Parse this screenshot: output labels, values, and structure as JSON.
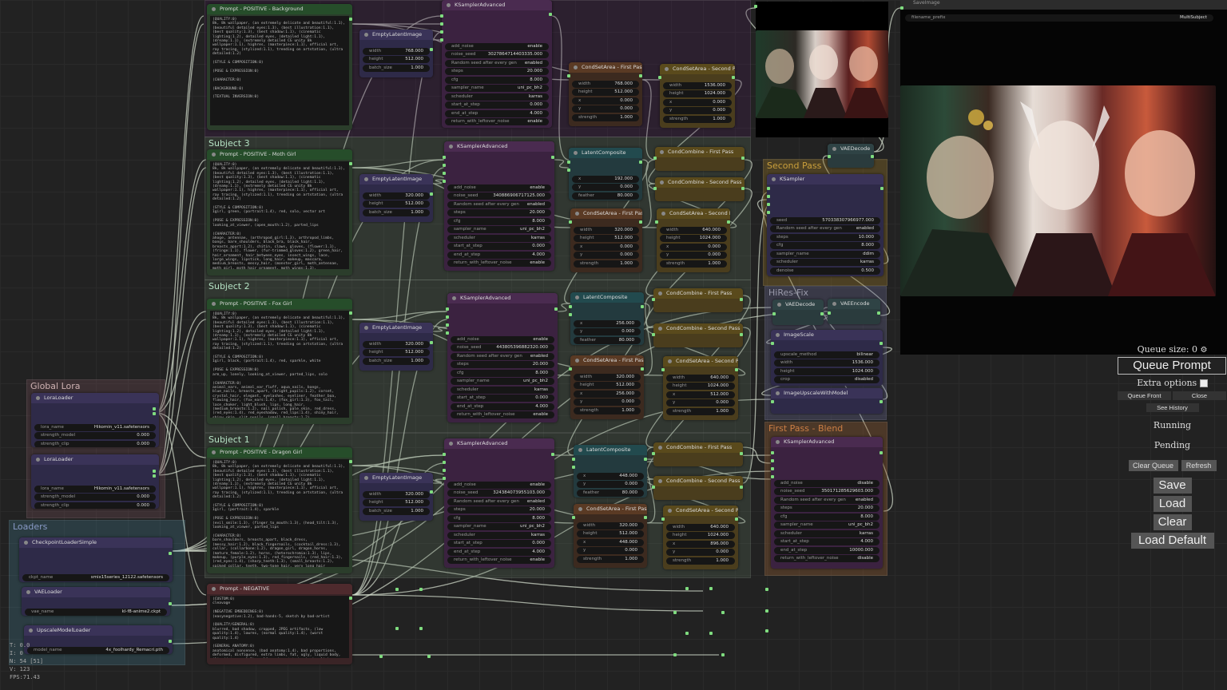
{
  "groups": {
    "subject3": "Subject 3",
    "subject2": "Subject 2",
    "subject1": "Subject 1",
    "global_lora": "Global Lora",
    "loaders": "Loaders",
    "second_pass": "Second Pass",
    "hires_fix": "HiRes-Fix",
    "first_pass_blend": "First Pass - Blend"
  },
  "nodes": {
    "prompt_bg": "Prompt - POSITIVE - Background",
    "prompt_moth": "Prompt - POSITIVE - Moth Girl",
    "prompt_fox": "Prompt - POSITIVE - Fox Girl",
    "prompt_dragon": "Prompt - POSITIVE - Dragon Girl",
    "prompt_neg": "Prompt - NEGATIVE",
    "empty_latent": "EmptyLatentImage",
    "ksampler_adv": "KSamplerAdvanced",
    "ksampler": "KSampler",
    "condset_first": "CondSetArea - First Pass",
    "condset_second": "CondSetArea - Second Pass",
    "condcombine_first": "CondCombine - First Pass",
    "condcombine_second": "CondCombine - Second Pass",
    "latent_composite": "LatentComposite",
    "vae_decode": "VAEDecode",
    "vae_encode": "VAEEncode",
    "image_scale": "ImageScale",
    "image_upscale_model": "ImageUpscaleWithModel",
    "lora_loader": "LoraLoader",
    "checkpoint_loader": "CheckpointLoaderSimple",
    "vae_loader": "VAELoader",
    "upscale_model_loader": "UpscaleModelLoader",
    "save_image": "SaveImage"
  },
  "prompts": {
    "background": "(QUALITY:0)\n8k, 8k wallpaper, (an extremely delicate and beautiful:1.1), (beautiful detailed eyes:1.3), (best illustration:1.1), (best quality:1.3), (best shadow:1.1), (cinematic lighting:1.2), detailed eyes, (detailed light:1.1), (dreamy:1.1), (extremely detailed CG unity 8k wallpaper:1.1), highres, (masterpiece:1.1), official art, ray tracing, (stylized:1.1), trending on artstation, (ultra detailed:1.2)\n\n(STYLE & COMPOSITION:0)\n\n(POSE & EXPRESSION:0)\n\n(CHARACTER:0)\n\n(BACKGROUND:0)\n\n(TEXTUAL INVERSION:0)",
    "moth": "(QUALITY:0)\n8k, 8k wallpaper, (an extremely delicate and beautiful:1.1), (beautiful detailed eyes:1.3), (best illustration:1.1), (best quality:1.3), (best shadow:1.1), (cinematic lighting:1.2), detailed eyes, (detailed light:1.1), (dreamy:1.1), (extremely detailed CG unity 8k wallpaper:1.1), highres, (masterpiece:1.1), official art, ray tracing, (stylized:1.1), trending on artstation, (ultra detailed:1.2)\n\n(STYLE & COMPOSITION:0)\n1girl, green, (portrait:1.4), red, solo, vector art\n\n(POSE & EXPRESSION:0)\nlooking_at_viewer, (open_mouth:1.2), parted_lips\n\n(CHARACTER:0)\nahoge, antennae, (arthropod_girl:1.3), arthropod_limbs, bangs, bare_shoulders, black_bra, black_hair, breasts_apart:1.2), chitin, claws, gloves, (flower:1.1), (fringe:1.1), flower, (fur-trimmed_gloves:1.2), green_hair, hair_ornament, hair_between_eyes, insect_wings, lace, large_wings, lipstick, long_hair, makeup, mascara, medium_breasts, messy_hair, (monster_girl, moth_antennae, moth_girl, moth_hair_ornament, moth_wings:1.3), multicolor_hair, nail_polish, red_bra, sideburns, (small_breasts:1.2), (tattoo:1.3), two-tone_hair:1.3, (yellow_eyes:1.3)",
    "fox": "(QUALITY:0)\n8k, 8k wallpaper, (an extremely delicate and beautiful:1.1), (beautiful detailed eyes:1.3), (best illustration:1.1), (best quality:1.3), (best shadow:1.1), (cinematic lighting:1.2), detailed eyes, (detailed light:1.1), (dreamy:1.1), (extremely detailed CG unity 8k wallpaper:1.1), highres, (masterpiece:1.1), official art, ray tracing, (stylized:1.1), trending on artstation, (ultra detailed:1.2)\n\n(STYLE & COMPOSITION:0)\n1girl, black, (portrait:1.4), red, sparkle, white\n\n(POSE & EXPRESSION:0)\narm_up, lonely, looking_at_viewer, parted_lips, solo\n\n(CHARACTER:0)\nanimal_ears, animal_ear_fluff, aqua_nails, bangs, blue_nails, breasts_apart, (bright_pupils:1.2), corset, crystal_hair, elegant, eyelashes, eyeliner, feather_boa, flowing_hair, (fox_ears:1.4), (fox_girl:1.3), fox_tail, lace_choker, light_blush, lips, long_hair, (medium_breasts:1.2), nail_polish, pale_skin, red_dress, (red_eyes:1.4), red_eyeshadow, red_lips:1.4), shiny_hair, shiny_skin, slit_pupils, (small_breasts:1.2), very_long_hair, white_choker, (white_hair:1.3)",
    "dragon": "(QUALITY:0)\n8k, 8k wallpaper, (an extremely delicate and beautiful:1.1), (beautiful detailed eyes:1.3), (best illustration:1.1), (best quality:1.3), (best shadow:1.1), (cinematic lighting:1.2), detailed eyes, (detailed light:1.1), (dreamy:1.1), (extremely detailed CG unity 8k wallpaper:1.1), highres, (masterpiece:1.1), official art, ray tracing, (stylized:1.1), trending on artstation, (ultra detailed:1.2)\n\n(STYLE & COMPOSITION:0)\n1girl, (portrait:1.4), sparkle\n\n(POSE & EXPRESSION:0)\n(evil_smile:1.3), (finger_to_mouth:1.3), (head_tilt:1.3), looking_at_viewer, parted_lips\n\n(CHARACTER:0)\nbare_shoulders, breasts_apart, black_dress, (messy_hair:1.2), black_fingernails, (cocktail_dress:1.3), collar, (collarbone:1.2), dragon_girl, dragon_horns, (mature_female:1.2), horns, (heterochromia:1.3), lips, makeup, (purple_eyes:1.3), red_fingernails, (red_hair:1.3), (red_eyes:1.4), (sharp_teeth:1.3), (small_breasts:1.2), spiked_collar, teeth, two-tone_hair, very_long_hair\n\n(BACKGROUND:0)",
    "negative": "(CUSTOM:0)\ncleavage\n\n(NEGATIVE EMBEDDINGS:0)\n(easynegative:1.2), bad-hands-5, sketch by bad-artist\n\n(QUALITY/GENERAL:0)\nblurred, bad shadow, cropped, JPEG artifacts, (low quality:1.4), lowres, (normal quality:1.4), (worst quality:1.4)\n\n(GENERAL ANATOMY:0)\nanatomical nonsense, (bad anatomy:1.4), bad proportions, deformed, disfigured, extra limbs, fat, ugly, liquid body, (liquid tongue:1.2), malformed, mutated, missing limbs, mutated, mutation, poorly drawn"
  },
  "labels": {
    "width": "width",
    "height": "height",
    "batch_size": "batch_size",
    "add_noise": "add_noise",
    "noise_seed": "noise_seed",
    "random_seed": "Random seed after every gen",
    "steps": "steps",
    "cfg": "cfg",
    "sampler_name": "sampler_name",
    "scheduler": "scheduler",
    "start_at_step": "start_at_step",
    "end_at_step": "end_at_step",
    "return_with_leftover_noise": "return_with_leftover_noise",
    "x": "x",
    "y": "y",
    "strength": "strength",
    "feather": "feather",
    "seed": "seed",
    "denoise": "denoise",
    "upscale_method": "upscale_method",
    "crop": "crop",
    "lora_name": "lora_name",
    "strength_model": "strength_model",
    "strength_clip": "strength_clip",
    "ckpt_name": "ckpt_name",
    "vae_name": "vae_name",
    "model_name": "model_name",
    "filename_prefix": "filename_prefix"
  },
  "values": {
    "enable": "enable",
    "disable": "disable",
    "enabled": "enabled",
    "w768": "768.000",
    "w1536": "1536.000",
    "w320": "320.000",
    "w640": "640.000",
    "h512": "512.000",
    "h1024": "1024.000",
    "one": "1.000",
    "zero": "0.000",
    "x192": "192.000",
    "x256": "256.000",
    "x448": "448.000",
    "x512": "512.000",
    "x896": "896.000",
    "f80": "80.000",
    "steps20": "20.000",
    "steps10": "10.000",
    "cfg8": "8.000",
    "end4": "4.000",
    "end10000": "10000.000",
    "half": "0.500",
    "sampler": "uni_pc_bh2",
    "karras": "karras",
    "ddim": "ddim",
    "bilinear": "bilinear",
    "disabled": "disabled",
    "seed_bg": "3027864714403335.000",
    "seed_moth": "340886906717125.000",
    "seed_fox": "443805396882320.000",
    "seed_dragon": "324384073955103.000",
    "seed_second": "570338307966977.000",
    "seed_blend": "350171285629603.000",
    "lora": "Hikomin_v11.safetensors",
    "ckpt": "smix15series_12122.safetensors",
    "vae": "kl-f8-anime2.ckpt",
    "upscale_model": "4x_foolhardy_Remacri.pth",
    "filename": "MultiSubject"
  },
  "menu": {
    "queue_size": "Queue size: 0",
    "queue_prompt": "Queue Prompt",
    "extra_options": "Extra options",
    "queue_front": "Queue Front",
    "close": "Close",
    "see_history": "See History",
    "running": "Running",
    "pending": "Pending",
    "clear_queue": "Clear Queue",
    "refresh": "Refresh",
    "save": "Save",
    "load": "Load",
    "clear": "Clear",
    "load_default": "Load Default"
  },
  "stats": {
    "t": "T: 0.0",
    "i": "I: 0",
    "n": "N: 54 [51]",
    "v": "V: 123",
    "fps": "FPS:71.43"
  },
  "colors": {
    "slot": "#7fdc7f",
    "wire": "#cfd8c8"
  }
}
